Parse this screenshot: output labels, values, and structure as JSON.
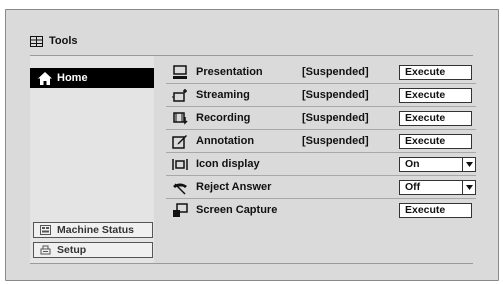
{
  "header": {
    "title": "Tools",
    "icon": "grid-icon"
  },
  "sidebar": {
    "home_label": "Home",
    "machine_status_label": "Machine Status",
    "setup_label": "Setup"
  },
  "rows": [
    {
      "label": "Presentation",
      "status": "[Suspended]",
      "action": "Execute",
      "icon": "monitor-icon"
    },
    {
      "label": "Streaming",
      "status": "[Suspended]",
      "action": "Execute",
      "icon": "streaming-icon"
    },
    {
      "label": "Recording",
      "status": "[Suspended]",
      "action": "Execute",
      "icon": "recording-icon"
    },
    {
      "label": "Annotation",
      "status": "[Suspended]",
      "action": "Execute",
      "icon": "annotation-icon"
    },
    {
      "label": "Icon display",
      "status": "",
      "select": "On",
      "icon": "icon-display-icon"
    },
    {
      "label": "Reject Answer",
      "status": "",
      "select": "Off",
      "icon": "reject-answer-icon"
    },
    {
      "label": "Screen Capture",
      "status": "",
      "action": "Execute",
      "icon": "screen-capture-icon"
    }
  ]
}
